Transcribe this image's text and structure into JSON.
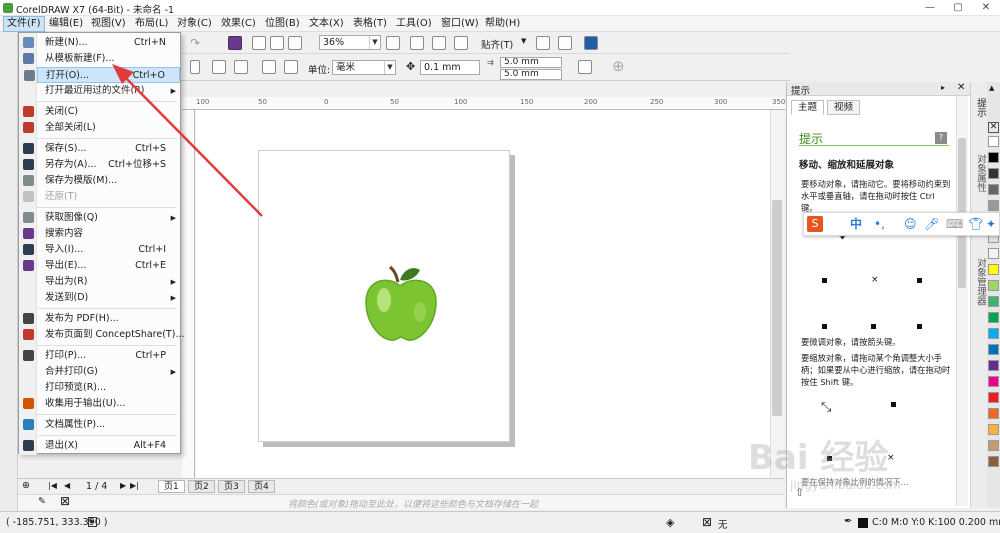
{
  "title": "CorelDRAW X7 (64-Bit) - 未命名 -1",
  "menu_bar": [
    "文件(F)",
    "编辑(E)",
    "视图(V)",
    "布局(L)",
    "对象(C)",
    "效果(C)",
    "位图(B)",
    "文本(X)",
    "表格(T)",
    "工具(O)",
    "窗口(W)",
    "帮助(H)"
  ],
  "toolbar": {
    "zoom": "36%",
    "snap": "贴齐(T)",
    "units_label": "单位:",
    "units": "毫米",
    "nudge": "0.1 mm",
    "dup_x": "5.0 mm",
    "dup_y": "5.0 mm"
  },
  "file_menu": [
    {
      "label": "新建(N)...",
      "shortcut": "Ctrl+N"
    },
    {
      "label": "从模板新建(F)...",
      "shortcut": ""
    },
    {
      "label": "打开(O)...",
      "shortcut": "Ctrl+O",
      "highlighted": true
    },
    {
      "label": "打开最近用过的文件(R)",
      "shortcut": "",
      "submenu": true
    },
    {
      "sep": true
    },
    {
      "label": "关闭(C)",
      "shortcut": ""
    },
    {
      "label": "全部关闭(L)",
      "shortcut": ""
    },
    {
      "sep": true
    },
    {
      "label": "保存(S)...",
      "shortcut": "Ctrl+S"
    },
    {
      "label": "另存为(A)...",
      "shortcut": "Ctrl+位移+S"
    },
    {
      "label": "保存为模版(M)...",
      "shortcut": ""
    },
    {
      "label": "还原(T)",
      "shortcut": "",
      "disabled": true
    },
    {
      "sep": true
    },
    {
      "label": "获取图像(Q)",
      "shortcut": "",
      "submenu": true
    },
    {
      "label": "搜索内容",
      "shortcut": ""
    },
    {
      "label": "导入(I)...",
      "shortcut": "Ctrl+I"
    },
    {
      "label": "导出(E)...",
      "shortcut": "Ctrl+E"
    },
    {
      "label": "导出为(R)",
      "shortcut": "",
      "submenu": true
    },
    {
      "label": "发送到(D)",
      "shortcut": "",
      "submenu": true
    },
    {
      "sep": true
    },
    {
      "label": "发布为 PDF(H)...",
      "shortcut": ""
    },
    {
      "label": "发布页面到 ConceptShare(T)...",
      "shortcut": ""
    },
    {
      "sep": true
    },
    {
      "label": "打印(P)...",
      "shortcut": "Ctrl+P"
    },
    {
      "label": "合并打印(G)",
      "shortcut": "",
      "submenu": true
    },
    {
      "label": "打印预览(R)...",
      "shortcut": ""
    },
    {
      "label": "收集用于输出(U)...",
      "shortcut": ""
    },
    {
      "sep": true
    },
    {
      "label": "文档属性(P)...",
      "shortcut": ""
    },
    {
      "sep": true
    },
    {
      "label": "退出(X)",
      "shortcut": "Alt+F4"
    }
  ],
  "ruler_labels": [
    "100",
    "50",
    "0",
    "50",
    "100",
    "150",
    "200",
    "250",
    "300",
    "350"
  ],
  "page_nav": {
    "counter": "1 / 4",
    "tabs": [
      "页1",
      "页2",
      "页3",
      "页4"
    ]
  },
  "palette_hint": "将颜色(或对象)拖动至此处，以便将这些颜色与文档存储在一起",
  "docker": {
    "title": "提示",
    "tabs": [
      "主题",
      "视频"
    ],
    "heading": "提示",
    "subheading": "移动、缩放和延展对象",
    "bullets": [
      "要移动对象，请拖动它。要将移动约束到水平或垂直轴，请在拖动时按住 Ctrl 键。",
      "要微调对象，请按箭头键。",
      "要缩放对象，请拖动某个角调整大小手柄；如果要从中心进行缩放，请在拖动时按住 Shift 键。",
      "要在保持对象比例的情况下..."
    ]
  },
  "side_tabs": [
    "提示",
    "对象属性",
    "对象管理器"
  ],
  "palette_colors": [
    "#ffffff",
    "#000000",
    "#333333",
    "#666666",
    "#999999",
    "#cccccc",
    "#e0e0e0",
    "#f2f2f2",
    "#ffff00",
    "#a0d468",
    "#3cb371",
    "#00a651",
    "#00aeef",
    "#0072bc",
    "#662d91",
    "#ec008c",
    "#ed1c24",
    "#f26522",
    "#fbb040",
    "#c69c6d",
    "#8b5e3c"
  ],
  "ime": {
    "lang": "中",
    "punct": "•,"
  },
  "status": {
    "coords": "( -185.751, 333.390 )",
    "fill_none": "无",
    "outline": "C:0 M:0 Y:0 K:100  0.200 mm"
  },
  "watermark": "Bai 经验",
  "watermark_url": "jingyan.baidu.com"
}
